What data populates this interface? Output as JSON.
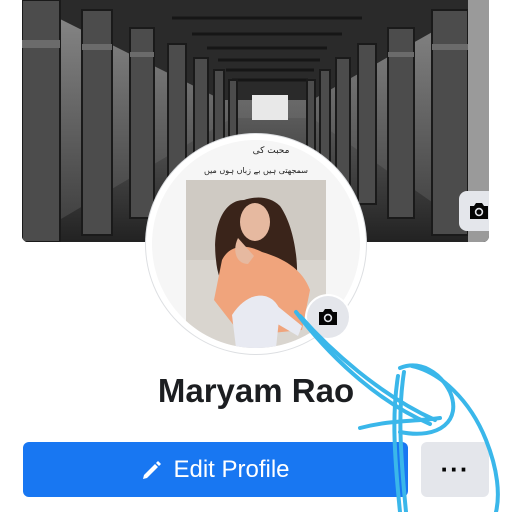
{
  "profile": {
    "name": "Maryam Rao",
    "avatar_caption_line1": "محبت کی",
    "avatar_caption_line2": "سمجھتی ہیں بے زباں ہوں میں"
  },
  "actions": {
    "edit_profile_label": "Edit Profile",
    "more_label": "···"
  },
  "icons": {
    "cover_camera": "camera-icon",
    "avatar_camera": "camera-icon",
    "edit": "pencil-icon"
  },
  "colors": {
    "primary": "#1877f2",
    "secondary_button": "#e4e6eb",
    "name_text": "#1c1e21",
    "annotation_stroke": "#3ab7ea"
  }
}
